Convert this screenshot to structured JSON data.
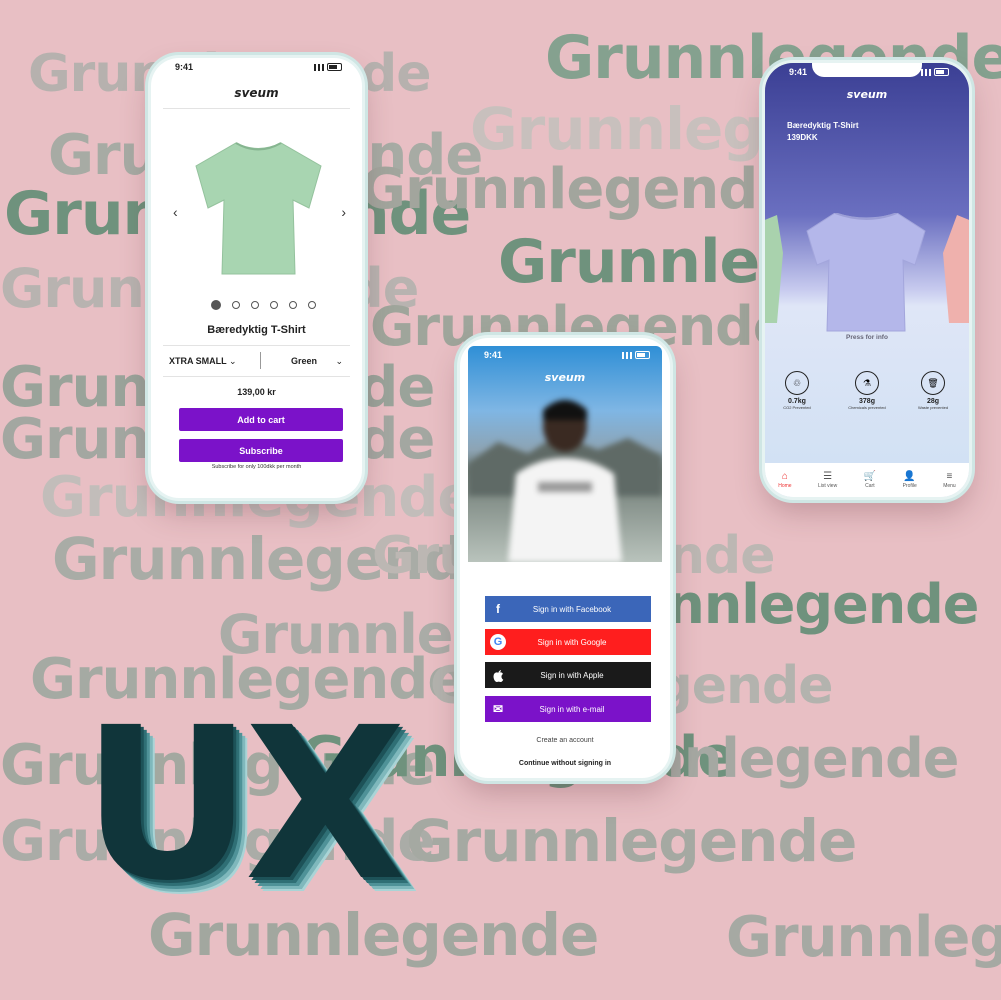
{
  "background_text": "Grunnlegende",
  "overlay_text": "UX",
  "colors": {
    "background": "#e8bfc4",
    "accent_purple": "#7b12c9",
    "green_text": "#6b8f7c",
    "gray_text": "#9aa59c"
  },
  "status_time": "9:41",
  "product_page": {
    "brand": "sveum",
    "image_icon": "tshirt-mint",
    "prev_icon": "‹",
    "next_icon": "›",
    "title": "Bæredyktig T-Shirt",
    "size_label": "XTRA SMALL",
    "color_label": "Green",
    "chevron": "⌄",
    "price": "139,00 kr",
    "add_to_cart": "Add to cart",
    "subscribe": "Subscribe",
    "subscribe_note": "Subscribe for only 100dkk per month",
    "carousel_index": 1,
    "carousel_count": 6
  },
  "signin_page": {
    "brand": "sveum",
    "buttons": [
      {
        "label": "Sign in with Facebook",
        "icon": "f",
        "color": "#3b66b9",
        "iconbg": "#2d55a2"
      },
      {
        "label": "Sign in with Google",
        "icon": "G",
        "color": "#ff1e1e",
        "iconbg": "#fff"
      },
      {
        "label": "Sign in with Apple",
        "icon": "",
        "color": "#1a1a1a",
        "iconbg": "#1a1a1a"
      },
      {
        "label": "Sign in with e-mail",
        "icon": "✉",
        "color": "#7b12c9",
        "iconbg": "#7b12c9"
      }
    ],
    "create_account": "Create an account",
    "continue_without": "Continue without signing in"
  },
  "detail_page": {
    "brand": "sveum",
    "product_name": "Bæredyktig T-Shirt",
    "price": "139DKK",
    "press_info": "Press for info",
    "stats": [
      {
        "value": "0.7kg",
        "label": "CO2 Prevented",
        "icon": "♲"
      },
      {
        "value": "378g",
        "label": "Chemicals prevented",
        "icon": "⚗"
      },
      {
        "value": "28g",
        "label": "Waste prevented",
        "icon": "🗑"
      }
    ],
    "tabs": [
      {
        "label": "Home",
        "icon": "⌂",
        "active": true
      },
      {
        "label": "List view",
        "icon": "☰",
        "active": false
      },
      {
        "label": "Cart",
        "icon": "🛒",
        "active": false
      },
      {
        "label": "Profile",
        "icon": "👤",
        "active": false
      },
      {
        "label": "Menu",
        "icon": "≡",
        "active": false
      }
    ]
  }
}
